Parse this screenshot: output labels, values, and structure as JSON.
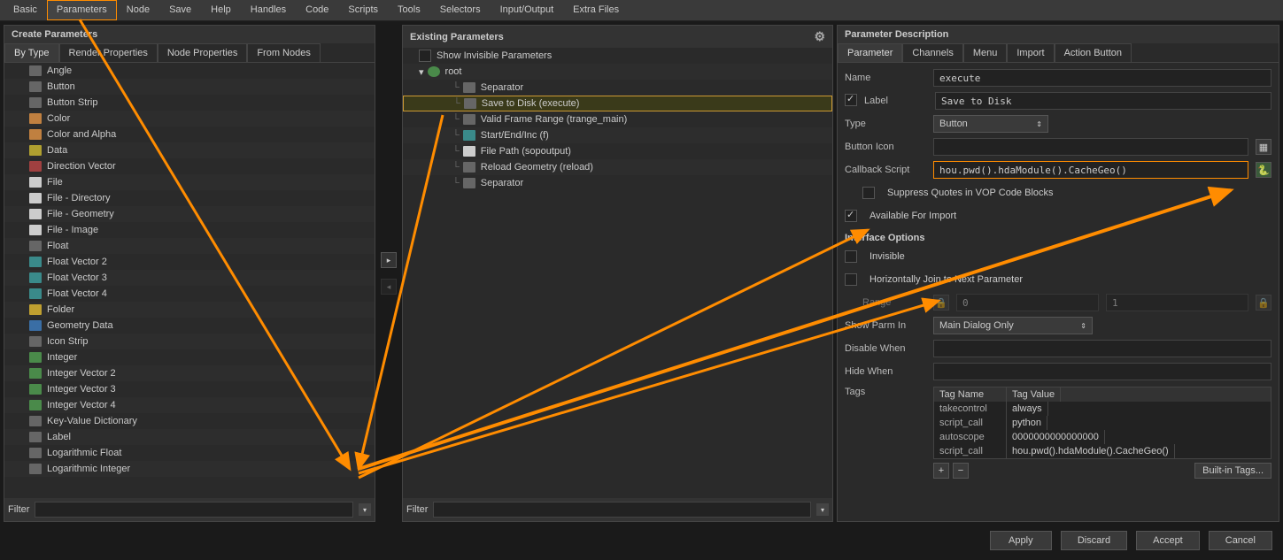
{
  "topmenu": [
    "Basic",
    "Parameters",
    "Node",
    "Save",
    "Help",
    "Handles",
    "Code",
    "Scripts",
    "Tools",
    "Selectors",
    "Input/Output",
    "Extra Files"
  ],
  "topmenu_active": 1,
  "panels": {
    "create": {
      "title": "Create Parameters",
      "tabs": [
        "By Type",
        "Render Properties",
        "Node Properties",
        "From Nodes"
      ],
      "active": 0,
      "filter_label": "Filter"
    },
    "existing": {
      "title": "Existing Parameters",
      "show_invisible": "Show Invisible Parameters",
      "filter_label": "Filter"
    },
    "desc": {
      "title": "Parameter Description",
      "tabs": [
        "Parameter",
        "Channels",
        "Menu",
        "Import",
        "Action Button"
      ],
      "active": 0
    }
  },
  "type_list": [
    {
      "label": "Angle",
      "ic": "gray"
    },
    {
      "label": "Button",
      "ic": "gray"
    },
    {
      "label": "Button Strip",
      "ic": "gray"
    },
    {
      "label": "Color",
      "ic": "orange"
    },
    {
      "label": "Color and Alpha",
      "ic": "orange"
    },
    {
      "label": "Data",
      "ic": "yellow"
    },
    {
      "label": "Direction Vector",
      "ic": "red"
    },
    {
      "label": "File",
      "ic": "white"
    },
    {
      "label": "File - Directory",
      "ic": "white"
    },
    {
      "label": "File - Geometry",
      "ic": "white"
    },
    {
      "label": "File - Image",
      "ic": "white"
    },
    {
      "label": "Float",
      "ic": "gray"
    },
    {
      "label": "Float Vector 2",
      "ic": "teal"
    },
    {
      "label": "Float Vector 3",
      "ic": "teal"
    },
    {
      "label": "Float Vector 4",
      "ic": "teal"
    },
    {
      "label": "Folder",
      "ic": "folder"
    },
    {
      "label": "Geometry Data",
      "ic": "blue"
    },
    {
      "label": "Icon Strip",
      "ic": "gray"
    },
    {
      "label": "Integer",
      "ic": "green"
    },
    {
      "label": "Integer Vector 2",
      "ic": "green"
    },
    {
      "label": "Integer Vector 3",
      "ic": "green"
    },
    {
      "label": "Integer Vector 4",
      "ic": "green"
    },
    {
      "label": "Key-Value Dictionary",
      "ic": "gray"
    },
    {
      "label": "Label",
      "ic": "gray"
    },
    {
      "label": "Logarithmic Float",
      "ic": "gray"
    },
    {
      "label": "Logarithmic Integer",
      "ic": "gray"
    }
  ],
  "existing_tree": {
    "root": "root",
    "items": [
      {
        "label": "Separator",
        "indent": 1,
        "ic": "gray"
      },
      {
        "label": "Save to Disk (execute)",
        "indent": 1,
        "ic": "gray",
        "sel": true
      },
      {
        "label": "Valid Frame Range (trange_main)",
        "indent": 1,
        "ic": "gray"
      },
      {
        "label": "Start/End/Inc (f)",
        "indent": 1,
        "ic": "teal"
      },
      {
        "label": "File Path (sopoutput)",
        "indent": 1,
        "ic": "white"
      },
      {
        "label": "Reload Geometry (reload)",
        "indent": 1,
        "ic": "gray"
      },
      {
        "label": "Separator",
        "indent": 1,
        "ic": "gray"
      }
    ]
  },
  "form": {
    "name_label": "Name",
    "name_value": "execute",
    "label_label": "Label",
    "label_checked": true,
    "label_value": "Save to Disk",
    "type_label": "Type",
    "type_value": "Button",
    "icon_label": "Button Icon",
    "icon_value": "",
    "callback_label": "Callback Script",
    "callback_value": "hou.pwd().hdaModule().CacheGeo()",
    "suppress": "Suppress Quotes in VOP Code Blocks",
    "avail": "Available For Import",
    "iface": "Interface Options",
    "invisible": "Invisible",
    "hjoin": "Horizontally Join to Next Parameter",
    "range_label": "Range",
    "range_lo": "0",
    "range_hi": "1",
    "showin_label": "Show Parm In",
    "showin_value": "Main Dialog Only",
    "disable_label": "Disable When",
    "disable_value": "",
    "hide_label": "Hide When",
    "hide_value": "",
    "tags_label": "Tags",
    "tags_headers": [
      "Tag Name",
      "Tag Value"
    ],
    "tags": [
      {
        "name": "takecontrol",
        "value": "always"
      },
      {
        "name": "script_call",
        "value": "python"
      },
      {
        "name": "autoscope",
        "value": "0000000000000000"
      },
      {
        "name": "script_call",
        "value": "hou.pwd().hdaModule().CacheGeo()"
      }
    ],
    "builtin": "Built-in Tags..."
  },
  "buttons": {
    "apply": "Apply",
    "discard": "Discard",
    "accept": "Accept",
    "cancel": "Cancel"
  }
}
